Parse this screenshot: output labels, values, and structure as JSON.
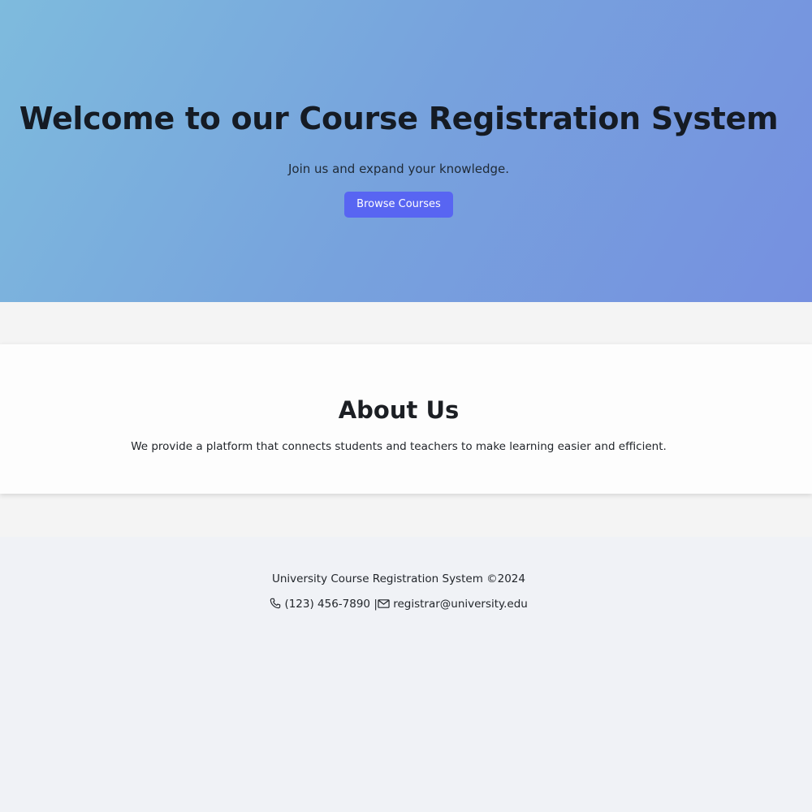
{
  "hero": {
    "title": "Welcome to our Course Registration System",
    "subtitle": "Join us and expand your knowledge.",
    "button_label": "Browse Courses"
  },
  "about": {
    "title": "About Us",
    "text": "We provide a platform that connects students and teachers to make learning easier and efficient."
  },
  "footer": {
    "copyright": "University Course Registration System ©2024",
    "phone_icon": "phone-icon",
    "phone": "(123) 456-7890",
    "separator": "|",
    "email_icon": "mail-icon",
    "email": "registrar@university.edu"
  },
  "colors": {
    "button": "#5865f2",
    "hero_gradient_start": "#7ebbdd",
    "hero_gradient_end": "#7690e0"
  }
}
